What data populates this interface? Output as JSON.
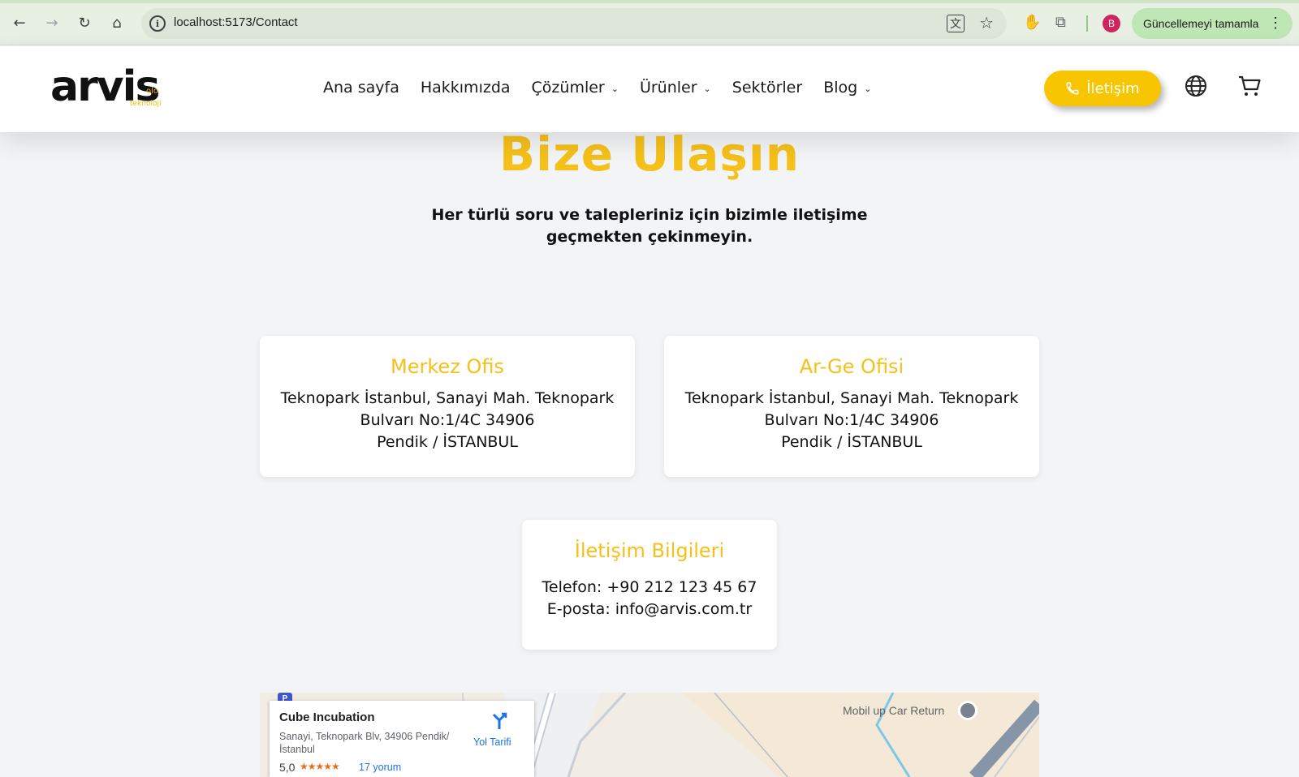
{
  "browser": {
    "url": "localhost:5173/Contact",
    "update_label": "Güncellemeyi tamamla",
    "profile_initial": "B"
  },
  "header": {
    "logo_text": "arvis",
    "logo_sub": "teknoloji",
    "logo_sup": "olo",
    "nav": [
      {
        "label": "Ana sayfa",
        "has_dropdown": false
      },
      {
        "label": "Hakkımızda",
        "has_dropdown": false
      },
      {
        "label": "Çözümler",
        "has_dropdown": true
      },
      {
        "label": "Ürünler",
        "has_dropdown": true
      },
      {
        "label": "Sektörler",
        "has_dropdown": false
      },
      {
        "label": "Blog",
        "has_dropdown": true
      }
    ],
    "contact_label": "İletişim"
  },
  "main": {
    "title": "Bize Ulaşın",
    "subtitle": "Her türlü soru ve talepleriniz için bizimle iletişime geçmekten çekinmeyin.",
    "offices": [
      {
        "title": "Merkez Ofis",
        "lines": [
          "Teknopark İstanbul, Sanayi Mah. Teknopark",
          "Bulvarı No:1/4C 34906",
          "Pendik / İSTANBUL"
        ]
      },
      {
        "title": "Ar-Ge Ofisi",
        "lines": [
          "Teknopark İstanbul, Sanayi Mah. Teknopark",
          "Bulvarı No:1/4C 34906",
          "Pendik / İSTANBUL"
        ]
      }
    ],
    "contact": {
      "title": "İletişim Bilgileri",
      "phone": "Telefon: +90 212 123 45 67",
      "email": "E-posta: info@arvis.com.tr"
    }
  },
  "map": {
    "place_name": "Cube Incubation",
    "address": "Sanayi, Teknopark Blv, 34906 Pendik/İstanbul",
    "rating": "5,0",
    "stars": "★★★★★",
    "reviews": "17 yorum",
    "directions_label": "Yol Tarifi",
    "poi_label": "Mobil up Car Return",
    "parking": "P"
  },
  "colors": {
    "accent": "#f5c01a",
    "button": "#f7c600",
    "page_bg": "#f3f4f6"
  }
}
